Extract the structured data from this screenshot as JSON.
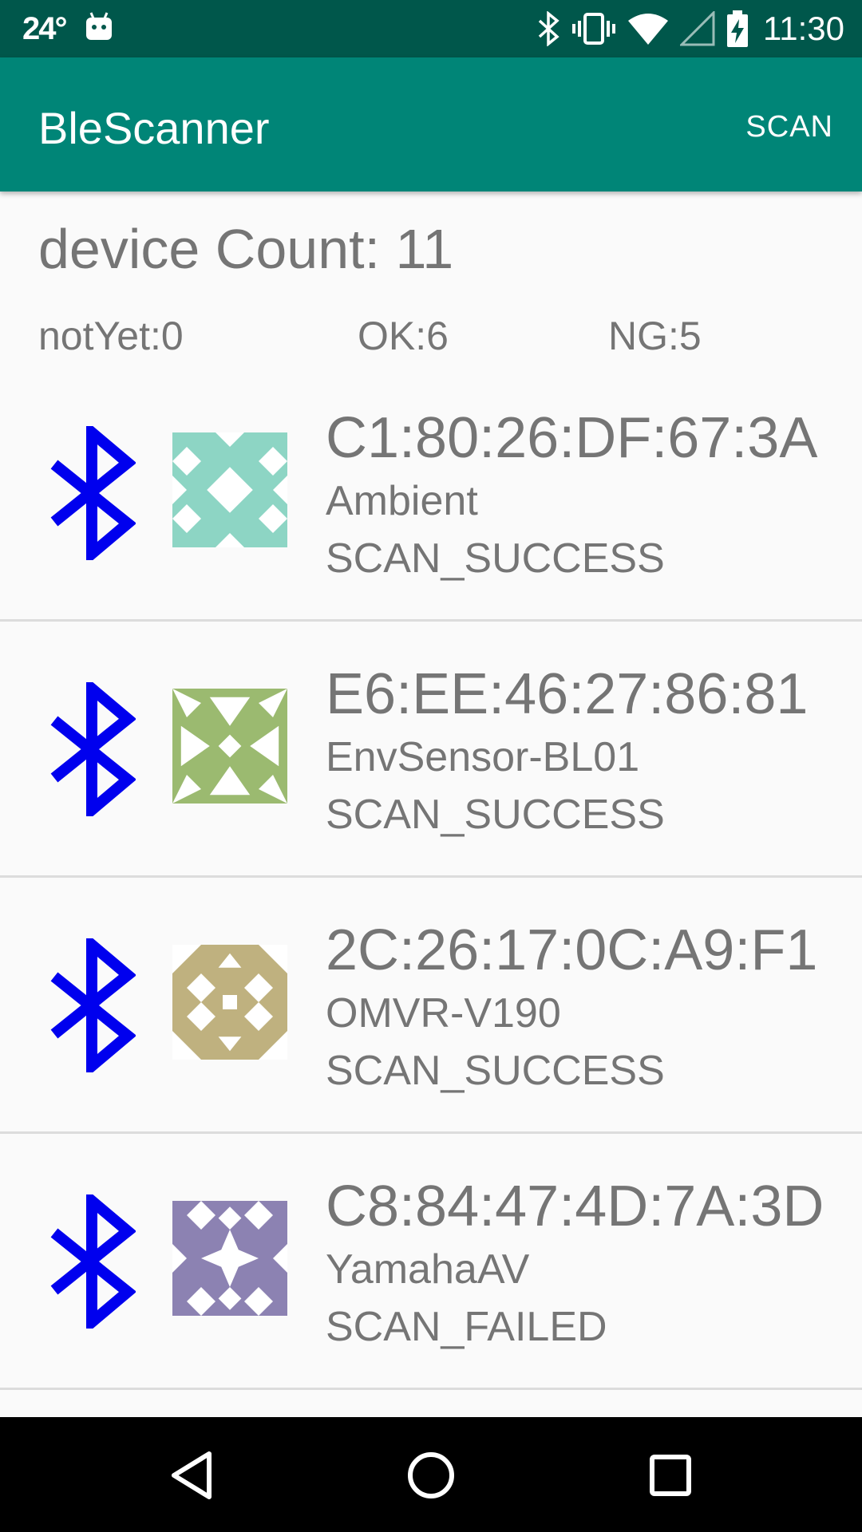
{
  "status_bar": {
    "temperature": "24°",
    "time": "11:30"
  },
  "app_bar": {
    "title": "BleScanner",
    "action_label": "SCAN"
  },
  "summary": {
    "device_count": "device Count: 11",
    "not_yet": "notYet:0",
    "ok": "OK:6",
    "ng": "NG:5"
  },
  "devices": [
    {
      "mac": "C1:80:26:DF:67:3A",
      "name": "Ambient",
      "status": "SCAN_SUCCESS",
      "identicon_color": "#8dd5c4"
    },
    {
      "mac": "E6:EE:46:27:86:81",
      "name": "EnvSensor-BL01",
      "status": "SCAN_SUCCESS",
      "identicon_color": "#9bba70"
    },
    {
      "mac": "2C:26:17:0C:A9:F1",
      "name": "OMVR-V190",
      "status": "SCAN_SUCCESS",
      "identicon_color": "#bfb17f"
    },
    {
      "mac": "C8:84:47:4D:7A:3D",
      "name": "YamahaAV",
      "status": "SCAN_FAILED",
      "identicon_color": "#8c82b2"
    }
  ],
  "icons": {
    "bluetooth_color": "#0000ee",
    "status_icons": [
      "bluetooth-icon",
      "vibrate-icon",
      "wifi-icon",
      "cell-signal-icon",
      "battery-charging-icon"
    ],
    "nav_icons": [
      "back-icon",
      "home-icon",
      "recents-icon"
    ]
  }
}
